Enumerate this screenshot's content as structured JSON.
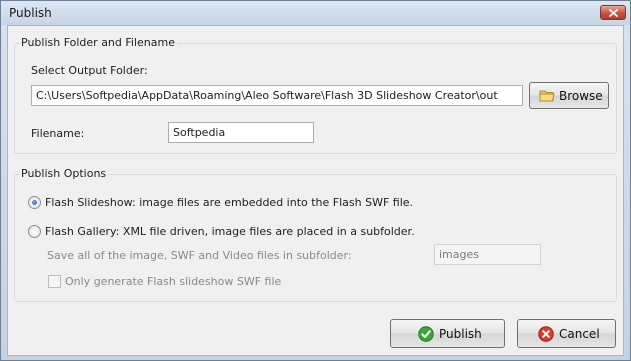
{
  "window": {
    "title": "Publish"
  },
  "folder_group": {
    "label": "Publish Folder and Filename",
    "select_label": "Select Output Folder:",
    "path_value": "C:\\Users\\Softpedia\\AppData\\Roaming\\Aleo Software\\Flash 3D Slideshow Creator\\out",
    "browse_label": "Browse",
    "filename_label": "Filename:",
    "filename_value": "Softpedia"
  },
  "options_group": {
    "label": "Publish Options",
    "slideshow_label": "Flash Slideshow: image files are embedded into the Flash SWF file.",
    "slideshow_selected": true,
    "gallery_label": "Flash Gallery: XML file driven, image files are placed in a subfolder.",
    "gallery_selected": false,
    "subfolder_label": "Save all of the image, SWF and Video files in subfolder:",
    "subfolder_value": "images",
    "only_swf_label": "Only generate Flash slideshow SWF file",
    "only_swf_checked": false
  },
  "buttons": {
    "publish_label": "Publish",
    "cancel_label": "Cancel"
  },
  "colors": {
    "publish_icon": "#3aa63a",
    "cancel_icon": "#d83a2e",
    "radio_dot": "#1e5aa8"
  }
}
